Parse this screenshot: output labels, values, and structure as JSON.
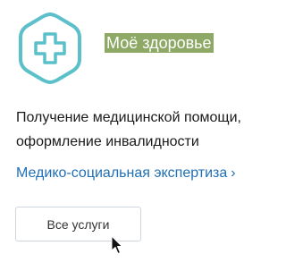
{
  "category": {
    "title": "Моё здоровье",
    "icon": "medical-cross-hexagon-icon",
    "icon_color": "#5bc0c9",
    "highlight_color": "#8ea966"
  },
  "description": "Получение медицинской помощи, оформление инвалидности",
  "link": {
    "label": "Медико-социальная экспертиза",
    "chevron": "›",
    "color": "#1f6fb5"
  },
  "button": {
    "label": "Все услуги"
  },
  "cursor": "arrow-cursor-icon"
}
